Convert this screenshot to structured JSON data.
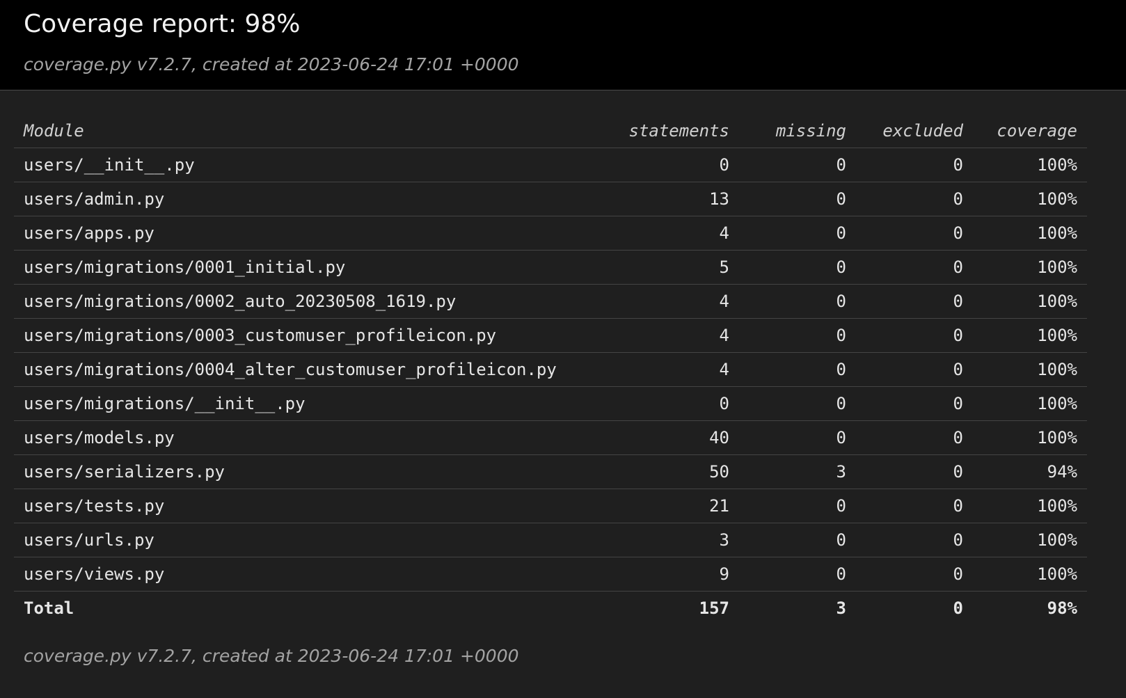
{
  "header": {
    "title": "Coverage report: 98%",
    "meta": "coverage.py v7.2.7, created at 2023-06-24 17:01 +0000"
  },
  "table": {
    "columns": [
      "Module",
      "statements",
      "missing",
      "excluded",
      "coverage"
    ],
    "rows": [
      {
        "module": "users/__init__.py",
        "statements": "0",
        "missing": "0",
        "excluded": "0",
        "coverage": "100%"
      },
      {
        "module": "users/admin.py",
        "statements": "13",
        "missing": "0",
        "excluded": "0",
        "coverage": "100%"
      },
      {
        "module": "users/apps.py",
        "statements": "4",
        "missing": "0",
        "excluded": "0",
        "coverage": "100%"
      },
      {
        "module": "users/migrations/0001_initial.py",
        "statements": "5",
        "missing": "0",
        "excluded": "0",
        "coverage": "100%"
      },
      {
        "module": "users/migrations/0002_auto_20230508_1619.py",
        "statements": "4",
        "missing": "0",
        "excluded": "0",
        "coverage": "100%"
      },
      {
        "module": "users/migrations/0003_customuser_profileicon.py",
        "statements": "4",
        "missing": "0",
        "excluded": "0",
        "coverage": "100%"
      },
      {
        "module": "users/migrations/0004_alter_customuser_profileicon.py",
        "statements": "4",
        "missing": "0",
        "excluded": "0",
        "coverage": "100%"
      },
      {
        "module": "users/migrations/__init__.py",
        "statements": "0",
        "missing": "0",
        "excluded": "0",
        "coverage": "100%"
      },
      {
        "module": "users/models.py",
        "statements": "40",
        "missing": "0",
        "excluded": "0",
        "coverage": "100%"
      },
      {
        "module": "users/serializers.py",
        "statements": "50",
        "missing": "3",
        "excluded": "0",
        "coverage": "94%"
      },
      {
        "module": "users/tests.py",
        "statements": "21",
        "missing": "0",
        "excluded": "0",
        "coverage": "100%"
      },
      {
        "module": "users/urls.py",
        "statements": "3",
        "missing": "0",
        "excluded": "0",
        "coverage": "100%"
      },
      {
        "module": "users/views.py",
        "statements": "9",
        "missing": "0",
        "excluded": "0",
        "coverage": "100%"
      }
    ],
    "total": {
      "module": "Total",
      "statements": "157",
      "missing": "3",
      "excluded": "0",
      "coverage": "98%"
    }
  },
  "footer": {
    "meta": "coverage.py v7.2.7, created at 2023-06-24 17:01 +0000"
  },
  "colors": {
    "header_bg": "#000000",
    "page_bg": "#1f1f1f",
    "text": "#e6e6e6",
    "muted": "#a3a3a3",
    "rule": "#444444"
  }
}
